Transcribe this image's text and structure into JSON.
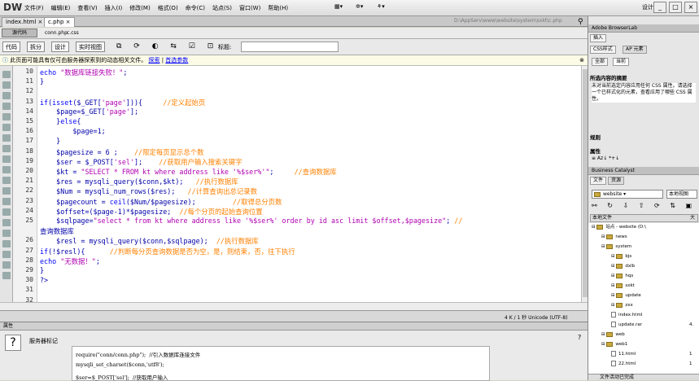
{
  "app": {
    "logo": "DW",
    "menus": [
      "文件(F)",
      "编辑(E)",
      "查看(V)",
      "插入(I)",
      "修改(M)",
      "格式(O)",
      "命令(C)",
      "站点(S)",
      "窗口(W)",
      "帮助(H)"
    ],
    "workspace": "设计器",
    "win": [
      "_",
      "□",
      "×"
    ]
  },
  "tabs": {
    "files": [
      "index.html",
      "c.php"
    ],
    "path": "D:\\AppServ\\www\\website\\system\\sxkt\\c.php",
    "related_src": "源代码",
    "related_files": [
      "conn.php",
      "c.css"
    ]
  },
  "toolbar": {
    "buttons": [
      "代码",
      "拆分",
      "设计",
      "实时视图"
    ],
    "title_label": "标题:"
  },
  "infobar": {
    "text": "此页面可能具有仅可由服务器探索到的动态相关文件。",
    "link1": "探索",
    "link2": "首选参数"
  },
  "code": {
    "start": 10,
    "lines": [
      "echo \"数据库链接失败！\";",
      "}",
      "",
      "if(isset($_GET['page'])){     //定义起始页",
      "    $page=$_GET['page'];",
      "    }else{",
      "        $page=1;",
      "    }",
      "    $pagesize = 6 ;    //限定每页显示总个数",
      "    $ser = $_POST['sel'];    //获取用户输入搜索关键字",
      "    $kt = \"SELECT * FROM kt where address like '%$ser%'\";     //查询数据库",
      "    $res = mysqli_query($conn,$kt);   //执行数据库",
      "    $Num = mysqli_num_rows($res);   //计算查询出总记录数",
      "    $pagecount = ceil($Num/$pagesize);         //取得总分页数",
      "    $offset=($page-1)*$pagesize;  //每个分页的起始查询位置",
      "    $sqlpage=\"select * from kt where address like '%$ser%' order by id asc limit $offset,$pagesize\"; //",
      "查询数据库",
      "    $resl = mysqli_query($conn,$sqlpage);  //执行数据库",
      "if(!$resl){      //判断每分页查询数据是否为空，是，则结束，否，往下执行",
      "echo \"无数据！\";",
      "}",
      "?>",
      "",
      ""
    ],
    "numbers": [
      "10",
      "11",
      "12",
      "13",
      "14",
      "15",
      "16",
      "17",
      "18",
      "19",
      "20",
      "21",
      "22",
      "23",
      "24",
      "25",
      "",
      "26",
      "27",
      "28",
      "29",
      "30",
      "31",
      "32"
    ]
  },
  "status": {
    "text": "4 K / 1 秒  Unicode (UTF-8)"
  },
  "properties": {
    "header": "属性",
    "label": "服务器标记",
    "code": [
      "require(\"conn/conn.php\");  //引入数据库连接文件",
      "mysqli_set_charset($conn,'utf8');",
      "$ser=$_POST['sel'];  //获取用户输入"
    ]
  },
  "right": {
    "browserlab": "Adobe BrowserLab",
    "insert": "插入",
    "css_tabs": [
      "CSS样式",
      "AP 元素"
    ],
    "css_subtabs": [
      "全部",
      "当前"
    ],
    "summary_title": "所选内容的摘要",
    "summary_text": "未对当前选定内容应用任何 CSS 属性。请选择一个已样式化的元素，查看应用了哪些 CSS 属性。",
    "rules": "规则",
    "props": "属性",
    "bc": "Business Catalyst",
    "file_tabs": [
      "文件",
      "资源"
    ],
    "site": "website",
    "view": "本地视图",
    "local_files": "本地文件",
    "size_col": "大",
    "tree": [
      {
        "label": "站点 - website (D:\\",
        "depth": 0,
        "type": "folder"
      },
      {
        "label": "news",
        "depth": 1,
        "type": "folder"
      },
      {
        "label": "system",
        "depth": 1,
        "type": "folder"
      },
      {
        "label": "bjs",
        "depth": 2,
        "type": "folder"
      },
      {
        "label": "dxlb",
        "depth": 2,
        "type": "folder"
      },
      {
        "label": "hqs",
        "depth": 2,
        "type": "folder"
      },
      {
        "label": "sxkt",
        "depth": 2,
        "type": "folder"
      },
      {
        "label": "update",
        "depth": 2,
        "type": "folder"
      },
      {
        "label": "zxx",
        "depth": 2,
        "type": "folder"
      },
      {
        "label": "index.html",
        "depth": 2,
        "type": "file"
      },
      {
        "label": "update.rar",
        "depth": 2,
        "type": "file"
      },
      {
        "label": "web",
        "depth": 1,
        "type": "folder"
      },
      {
        "label": "web1",
        "depth": 1,
        "type": "folder"
      },
      {
        "label": "11.html",
        "depth": 2,
        "type": "file"
      },
      {
        "label": "22.html",
        "depth": 2,
        "type": "file"
      }
    ],
    "sizes": {
      "update.rar": "4.",
      "11.html": "1",
      "22.html": "1"
    },
    "footer": "文件活动已完成"
  },
  "colors": {
    "keyword": "#0000ff",
    "comment": "#ff8000",
    "string": "#b000b0",
    "plain": "#0000aa"
  }
}
